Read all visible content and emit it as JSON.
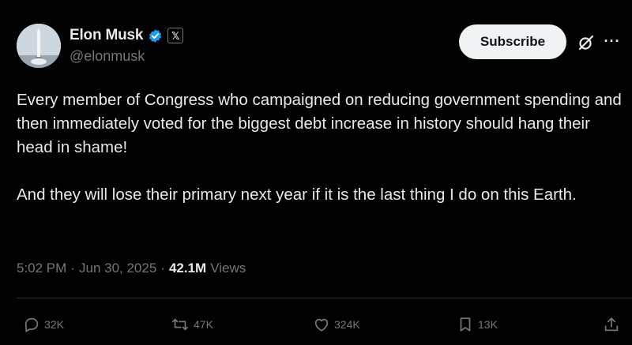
{
  "author": {
    "display_name": "Elon Musk",
    "handle": "@elonmusk",
    "verified_icon": "verified-badge-icon",
    "affiliate_badge": "𝕏"
  },
  "header": {
    "subscribe_label": "Subscribe",
    "grok_icon": "grok-icon",
    "more_icon": "more-icon",
    "more_glyph": "···"
  },
  "tweet": {
    "paragraphs": [
      "Every member of Congress who campaigned on reducing government spending and then immediately voted for the biggest debt increase in history should hang their head in shame!",
      "And they will lose their primary next year if it is the last thing I do on this Earth."
    ]
  },
  "meta": {
    "time": "5:02 PM",
    "separator": "·",
    "date": "Jun 30, 2025",
    "views_count": "42.1M",
    "views_label": "Views"
  },
  "actions": {
    "replies": "32K",
    "reposts": "47K",
    "likes": "324K",
    "bookmarks": "13K"
  },
  "colors": {
    "background": "#000000",
    "text_primary": "#e7e9ea",
    "text_secondary": "#71767b",
    "verified_blue": "#1d9bf0",
    "subscribe_bg": "#eff3f4",
    "divider": "#2f3336"
  }
}
